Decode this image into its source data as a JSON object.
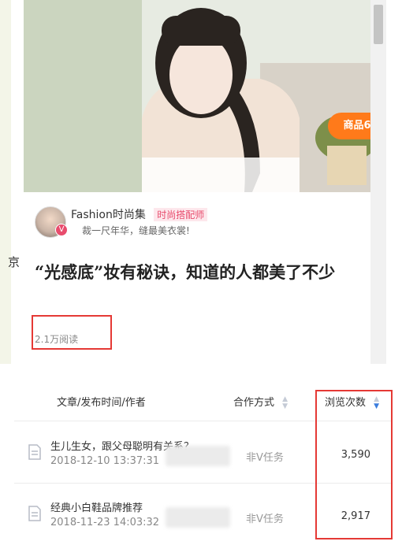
{
  "card": {
    "goods_badge": "商品6",
    "author_name": "Fashion时尚集",
    "author_tag": "时尚搭配师",
    "verified_mark": "V",
    "author_bio": "裁一尺年华，缝最美衣裳!",
    "headline": "“光感底”妆有秘诀，知道的人都美了不少",
    "read_count": "2.1万阅读",
    "left_edge_glyph": "京"
  },
  "table": {
    "headers": {
      "article": "文章/发布时间/作者",
      "coop": "合作方式",
      "views": "浏览次数"
    },
    "rows": [
      {
        "title": "生儿生女，跟父母聪明有关系？",
        "time": "2018-12-10 13:37:31",
        "coop": "非V任务",
        "views": "3,590"
      },
      {
        "title": "经典小白鞋品牌推荐",
        "time": "2018-11-23 14:03:32",
        "coop": "非V任务",
        "views": "2,917"
      }
    ]
  },
  "colors": {
    "accent_orange": "#ff7a1a",
    "highlight_red": "#e53935",
    "tag_pink": "#e84c6d",
    "sort_active": "#3b7ddd"
  },
  "icons": {
    "row_icon": "document-icon",
    "sort": "sort-icon"
  }
}
